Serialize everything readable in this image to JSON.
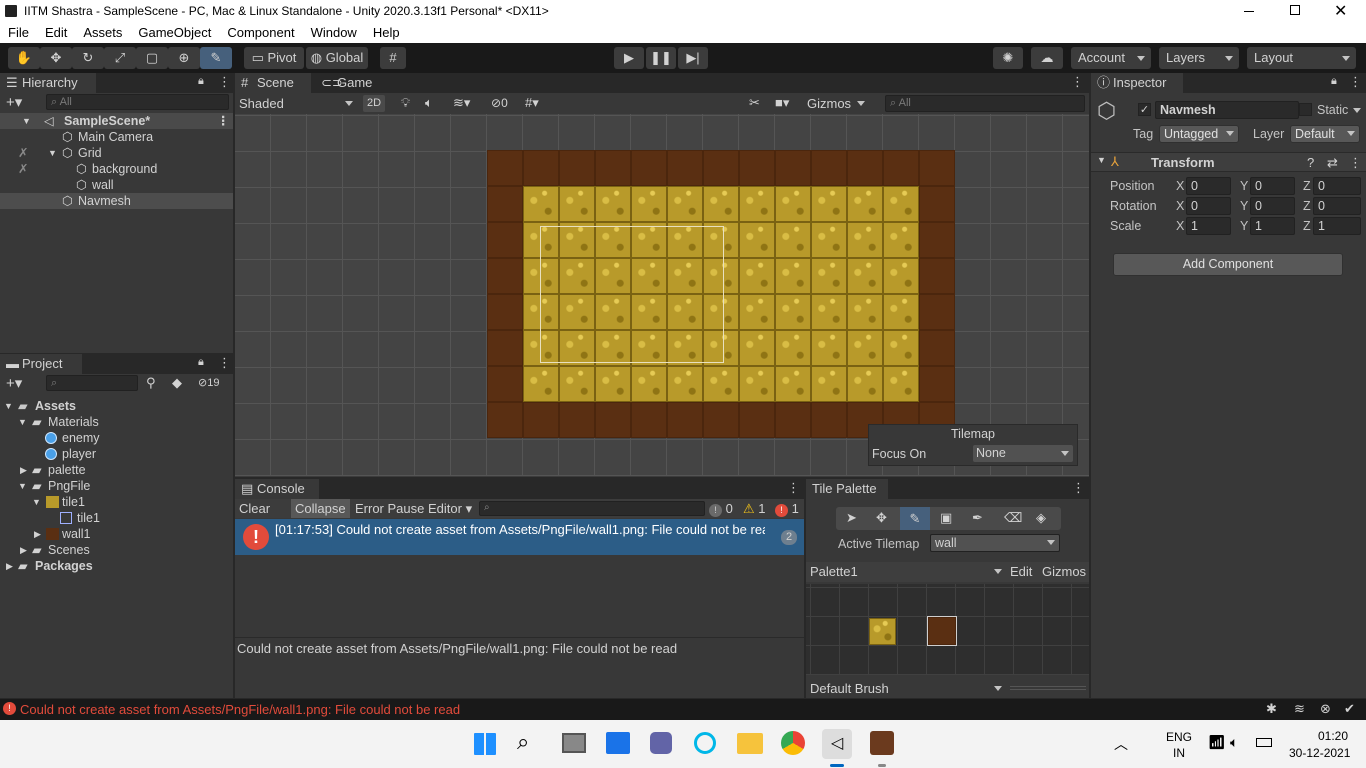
{
  "window": {
    "title": "IITM Shastra - SampleScene - PC, Mac & Linux Standalone - Unity 2020.3.13f1 Personal* <DX11>"
  },
  "menu": [
    "File",
    "Edit",
    "Assets",
    "GameObject",
    "Component",
    "Window",
    "Help"
  ],
  "toolbar": {
    "pivot": "Pivot",
    "global": "Global",
    "account": "Account",
    "layers": "Layers",
    "layout": "Layout"
  },
  "hierarchy": {
    "tab": "Hierarchy",
    "search_placeholder": "All",
    "scene": "SampleScene*",
    "items": [
      {
        "label": "Main Camera"
      },
      {
        "label": "Grid"
      },
      {
        "label": "background"
      },
      {
        "label": "wall"
      },
      {
        "label": "Navmesh"
      }
    ]
  },
  "scene_view": {
    "tab_scene": "Scene",
    "tab_game": "Game",
    "shading": "Shaded",
    "mode_2d": "2D",
    "hidden_count": "0",
    "gizmos": "Gizmos",
    "search_placeholder": "All",
    "tilemap_overlay": {
      "title": "Tilemap",
      "focus_label": "Focus On",
      "focus_value": "None"
    }
  },
  "inspector": {
    "tab": "Inspector",
    "object_name": "Navmesh",
    "static_label": "Static",
    "tag_label": "Tag",
    "tag_value": "Untagged",
    "layer_label": "Layer",
    "layer_value": "Default",
    "transform": {
      "title": "Transform",
      "rows": [
        {
          "label": "Position",
          "x": "0",
          "y": "0",
          "z": "0"
        },
        {
          "label": "Rotation",
          "x": "0",
          "y": "0",
          "z": "0"
        },
        {
          "label": "Scale",
          "x": "1",
          "y": "1",
          "z": "1"
        }
      ]
    },
    "add_component": "Add Component"
  },
  "project": {
    "tab": "Project",
    "hidden_count": "19",
    "tree": [
      {
        "label": "Assets"
      },
      {
        "label": "Materials"
      },
      {
        "label": "enemy"
      },
      {
        "label": "player"
      },
      {
        "label": "palette"
      },
      {
        "label": "PngFile"
      },
      {
        "label": "tile1"
      },
      {
        "label": "tile1"
      },
      {
        "label": "wall1"
      },
      {
        "label": "Scenes"
      },
      {
        "label": "Packages"
      }
    ]
  },
  "console": {
    "tab": "Console",
    "clear": "Clear",
    "collapse": "Collapse",
    "error_pause": "Error Pause",
    "editor": "Editor",
    "info_count": "0",
    "warn_count": "1",
    "error_count": "1",
    "entry": {
      "text": "[01:17:53] Could not create asset from Assets/PngFile/wall1.png: File could not be read",
      "count": "2"
    },
    "detail": "Could not create asset from Assets/PngFile/wall1.png: File could not be read"
  },
  "tile_palette": {
    "tab": "Tile Palette",
    "active_tilemap_label": "Active Tilemap",
    "active_tilemap_value": "wall",
    "palette_name": "Palette1",
    "edit": "Edit",
    "gizmos": "Gizmos",
    "brush": "Default Brush"
  },
  "status_bar": {
    "message": "Could not create asset from Assets/PngFile/wall1.png: File could not be read"
  },
  "taskbar": {
    "lang_top": "ENG",
    "lang_bottom": "IN",
    "time": "01:20",
    "date": "30-12-2021"
  },
  "colors": {
    "accent": "#46607c",
    "error": "#e24b3b",
    "selection": "#2c5d87",
    "wall": "#5a2f12",
    "grass": "#b89a2a"
  }
}
